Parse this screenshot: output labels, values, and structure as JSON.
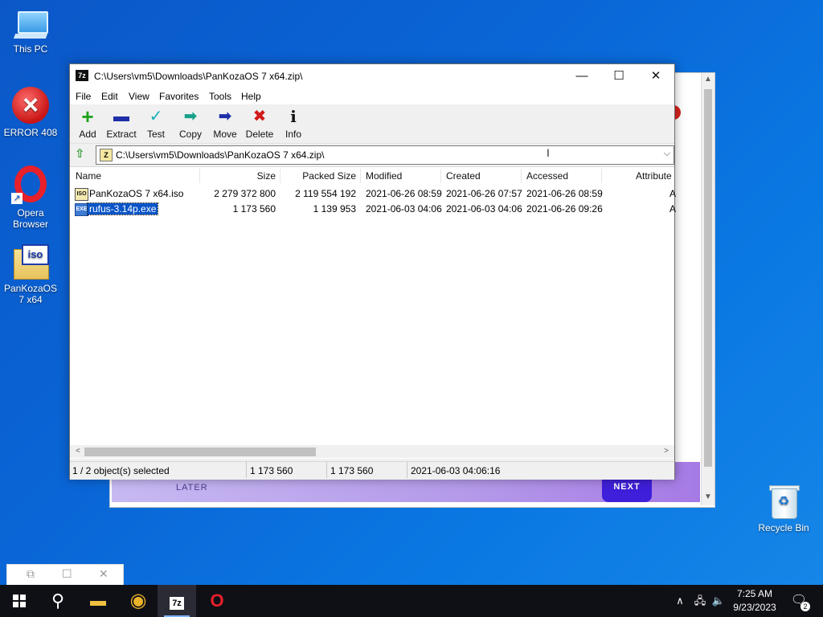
{
  "desktop": {
    "icons": [
      {
        "label": "This PC",
        "icon": "computer-icon"
      },
      {
        "label": "ERROR 408",
        "icon": "error-icon"
      },
      {
        "label": "Opera Browser",
        "icon": "opera-icon"
      },
      {
        "label": "PanKozaOS 7 x64",
        "icon": "iso-folder-icon"
      },
      {
        "label": "Recycle Bin",
        "icon": "recycle-bin-icon"
      }
    ]
  },
  "bg_dialog": {
    "later_label": "LATER",
    "next_label": "NEXT",
    "accent_color": "#3f1fd9"
  },
  "window": {
    "app_icon_text": "7z",
    "title": "C:\\Users\\vm5\\Downloads\\PanKozaOS 7 x64.zip\\",
    "minimize_glyph": "—",
    "maximize_glyph": "☐",
    "close_glyph": "✕",
    "menu": [
      "File",
      "Edit",
      "View",
      "Favorites",
      "Tools",
      "Help"
    ],
    "toolbar": [
      {
        "label": "Add",
        "icon": "plus-icon",
        "glyph": "+",
        "color": "#1fa31f"
      },
      {
        "label": "Extract",
        "icon": "minus-icon",
        "glyph": "▬",
        "color": "#1e2fa8"
      },
      {
        "label": "Test",
        "icon": "check-icon",
        "glyph": "✓",
        "color": "#17b0b7"
      },
      {
        "label": "Copy",
        "icon": "copy-arrow-icon",
        "glyph": "➡",
        "color": "#17a08a"
      },
      {
        "label": "Move",
        "icon": "move-arrow-icon",
        "glyph": "➡",
        "color": "#1e2fa8"
      },
      {
        "label": "Delete",
        "icon": "delete-x-icon",
        "glyph": "✖",
        "color": "#d21a1a"
      },
      {
        "label": "Info",
        "icon": "info-icon",
        "glyph": "i",
        "color": "#111111"
      }
    ],
    "address": {
      "up_glyph": "⇧",
      "zip_icon_text": "Z",
      "path": "C:\\Users\\vm5\\Downloads\\PanKozaOS 7 x64.zip\\",
      "dropdown_glyph": "⌵",
      "cursor_glyph": "I"
    },
    "columns": [
      "Name",
      "Size",
      "Packed Size",
      "Modified",
      "Created",
      "Accessed",
      "Attribute"
    ],
    "files": [
      {
        "name": "PanKozaOS 7 x64.iso",
        "icon": "iso-file-icon",
        "icon_text": "ISO",
        "size": "2 279 372 800",
        "packed": "2 119 554 192",
        "modified": "2021-06-26 08:59",
        "created": "2021-06-26 07:57",
        "accessed": "2021-06-26 08:59",
        "attr": "A"
      },
      {
        "name": "rufus-3.14p.exe",
        "icon": "exe-file-icon",
        "icon_text": "EXE",
        "size": "1 173 560",
        "packed": "1 139 953",
        "modified": "2021-06-03 04:06",
        "created": "2021-06-03 04:06",
        "accessed": "2021-06-26 09:26",
        "attr": "A"
      }
    ],
    "hscroll": {
      "left_glyph": "<",
      "right_glyph": ">"
    },
    "status": {
      "selected": "1 / 2 object(s) selected",
      "size": "1 173 560",
      "packed": "1 173 560",
      "date": "2021-06-03 04:06:16"
    }
  },
  "snap_ghost": {
    "glyphs": [
      "⧉",
      "☐",
      "✕"
    ]
  },
  "taskbar": {
    "search_glyph": "⚲",
    "apps": [
      {
        "name": "File Explorer",
        "icon": "folder-icon",
        "glyph": "▬"
      },
      {
        "name": "Chrome",
        "icon": "chrome-icon",
        "glyph": "◉"
      },
      {
        "name": "7-Zip",
        "icon": "sevenzip-icon",
        "glyph": "7z"
      },
      {
        "name": "Opera",
        "icon": "opera-taskbar-icon",
        "glyph": "O"
      }
    ],
    "tray": {
      "chevron_glyph": "∧",
      "network_glyph": "🖧",
      "volume_glyph": "🔈"
    },
    "time": "7:25 AM",
    "date": "9/23/2023",
    "notif_glyph": "🗨",
    "notif_count": "2"
  }
}
